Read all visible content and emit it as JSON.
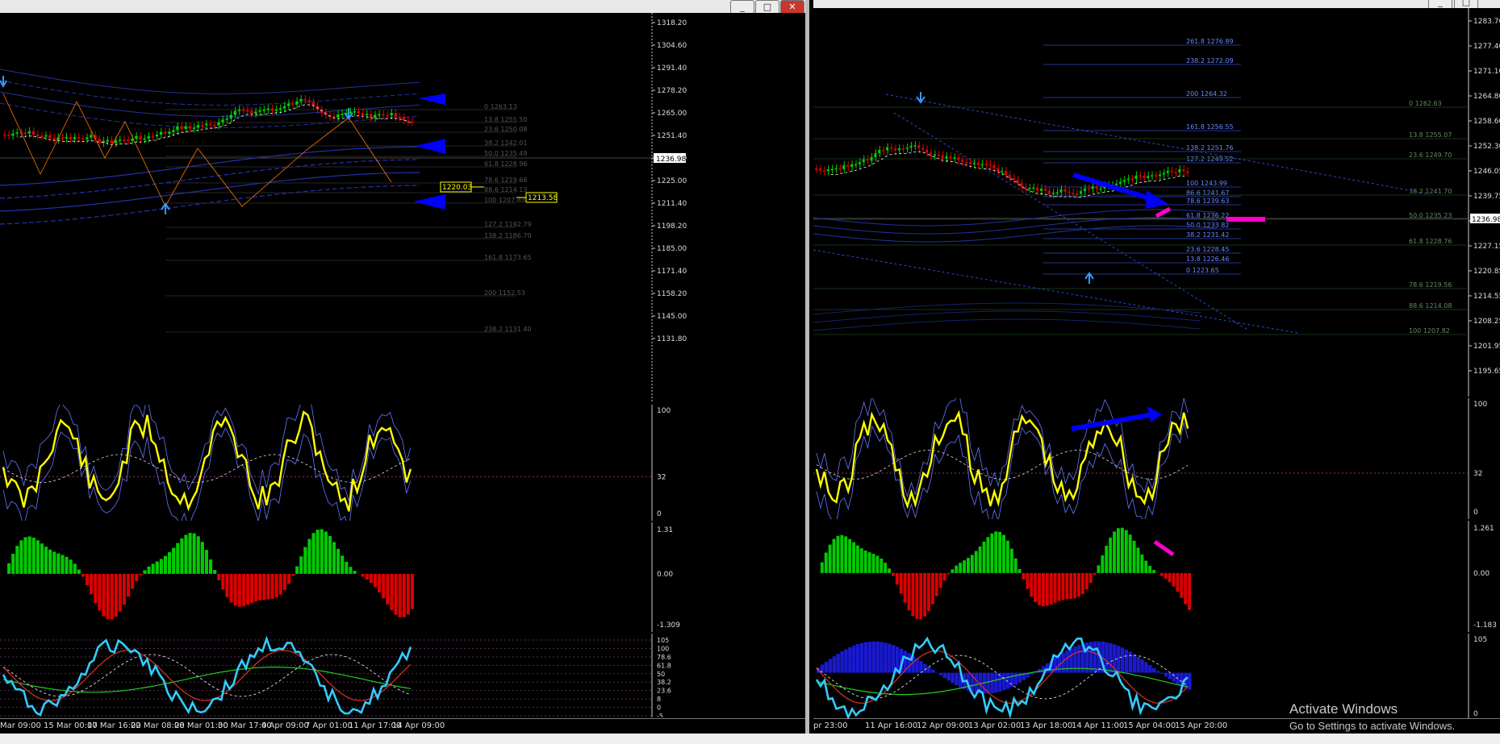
{
  "colors": {
    "background": "#000000",
    "price_bull": "#00d000",
    "price_bear": "#e00000",
    "rsi": "#ffff00",
    "stoch": "#33ccff",
    "osma_up": "#00cc00",
    "osma_down": "#dd0000",
    "arrow": "#0000ff",
    "pink": "#ff00cc"
  },
  "icons": [
    "minimize-icon",
    "restore-icon",
    "close-icon",
    "arrow-down-icon",
    "arrow-up-icon",
    "triangle-left-icon"
  ],
  "left": {
    "window_buttons": {
      "minimize": "_",
      "restore": "□",
      "close": "✕"
    },
    "price_scale": [
      "1318.20",
      "1304.60",
      "1291.40",
      "1278.20",
      "1265.00",
      "1251.40",
      "1238.20",
      "1225.00",
      "1211.40",
      "1198.20",
      "1185.00",
      "1171.40",
      "1158.20",
      "1145.00",
      "1131.80"
    ],
    "current_price": "1236.98",
    "tags": [
      "1220.03",
      "1213.58"
    ],
    "fibs": [
      "0 1263.13",
      "13.8 1255.50",
      "23.6 1250.08",
      "38.2 1242.01",
      "50.0 1235.49",
      "61.8 1228.96",
      "78.6 1219.66",
      "88.6 1214.13",
      "100 1207.83",
      "127.2 1192.79",
      "138.2 1186.70",
      "161.8 1173.65",
      "200 1152.53",
      "238.2 1131.40"
    ],
    "rsi_scale": [
      "100",
      "32",
      "0"
    ],
    "osma_scale": [
      "1.31",
      "0.00",
      "-1.309"
    ],
    "stoch_scale": [
      "105",
      "100",
      "78.6",
      "61.8",
      "50",
      "38.2",
      "23.6",
      "8",
      "0",
      "-5"
    ],
    "time_labels": [
      "Mar 09:00",
      "15 Mar 00:00",
      "17 Mar 16:00",
      "22 Mar 08:00",
      "28 Mar 01:00",
      "30 Mar 17:00",
      "4 Apr 09:00",
      "7 Apr 01:00",
      "11 Apr 17:00",
      "14 Apr 09:00"
    ]
  },
  "right": {
    "window_buttons": {
      "minimize": "_",
      "restore": "□"
    },
    "price_scale": [
      "1283.70",
      "1277.40",
      "1271.10",
      "1264.80",
      "1258.60",
      "1252.30",
      "1246.05",
      "1239.75",
      "1233.45",
      "1227.15",
      "1220.85",
      "1214.55",
      "1208.25",
      "1201.95",
      "1195.65"
    ],
    "current_price": "1236.98",
    "fibs_main": [
      "261.8 1276.89",
      "238.2 1272.09",
      "200 1264.32",
      "161.8 1256.55",
      "138.2 1251.76",
      "127.2 1249.52",
      "100 1243.99",
      "86.6 1241.67",
      "78.6 1239.63",
      "61.8 1236.22",
      "50.0 1233.82",
      "38.2 1231.42",
      "23.6 1228.45",
      "13.8 1226.46",
      "0 1223.65"
    ],
    "fibs_right": [
      "0 1262.63",
      "13.8 1255.07",
      "23.6 1249.70",
      "38.2 1241.70",
      "50.0 1235.23",
      "61.8 1228.76",
      "78.6 1219.56",
      "88.6 1214.08",
      "100 1207.82"
    ],
    "rsi_scale": [
      "100",
      "32",
      "0"
    ],
    "osma_scale": [
      "1.261",
      "0.00",
      "-1.183"
    ],
    "stoch_scale": [
      "105",
      "0"
    ],
    "time_labels": [
      "pr 23:00",
      "11 Apr 16:00",
      "12 Apr 09:00",
      "13 Apr 02:00",
      "13 Apr 18:00",
      "14 Apr 11:00",
      "15 Apr 04:00",
      "15 Apr 20:00"
    ],
    "watermark_title": "Activate Windows",
    "watermark_sub": "Go to Settings to activate Windows."
  }
}
